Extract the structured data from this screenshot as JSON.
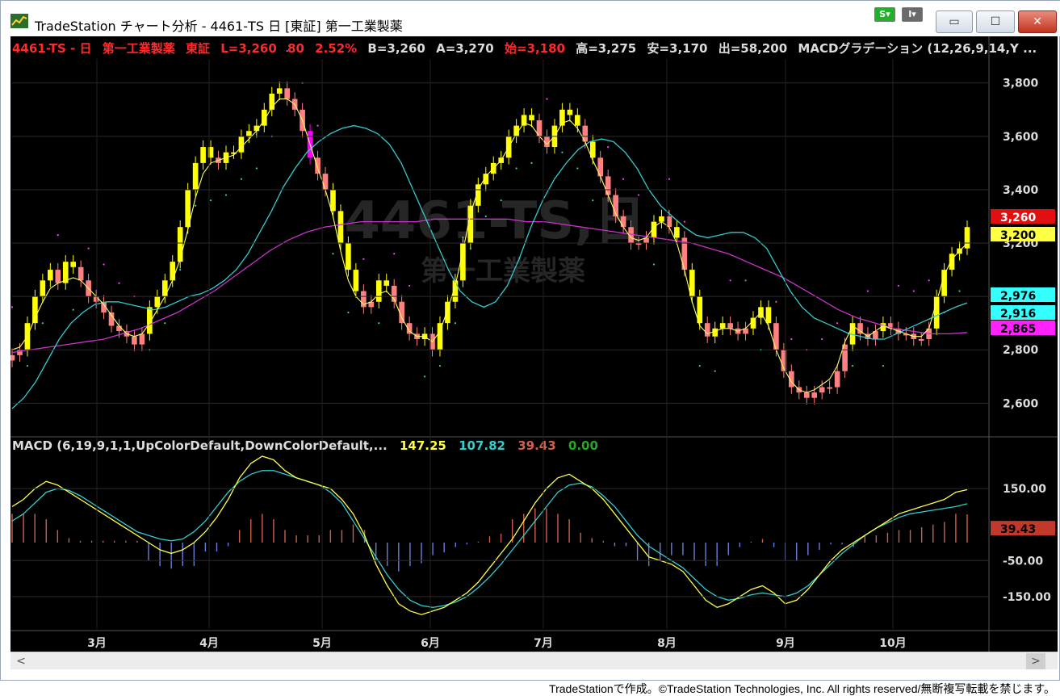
{
  "window": {
    "title": "TradeStation チャート分析 - 4461-TS 日 [東証] 第一工業製薬",
    "s_button": "S",
    "i_button": "I",
    "minimize_glyph": "▭",
    "maximize_glyph": "☐",
    "close_glyph": "✕"
  },
  "header": {
    "symbol_line": "4461-TS - 日",
    "company": "第一工業製薬",
    "exchange": "東証",
    "last": "L=3,260",
    "change": "80",
    "change_pct": "2.52%",
    "bid": "B=3,260",
    "ask": "A=3,270",
    "open": "始=3,180",
    "high": "高=3,275",
    "low": "安=3,170",
    "volume": "出=58,200",
    "indicator": "MACDグラデーション (12,26,9,14,Y ..."
  },
  "watermark": {
    "symbol": "4461-TS,日",
    "name": "第一工業製薬"
  },
  "macd_header": {
    "label": "MACD (6,19,9,1,1,UpColorDefault,DownColorDefault,...",
    "macd": "147.25",
    "signal": "107.82",
    "diff": "39.43",
    "zero": "0.00"
  },
  "price_tags": [
    "3,260",
    "3,200",
    "2,976",
    "2,916",
    "2,865"
  ],
  "macd_tag": "39.43",
  "scrollbar": {
    "left_glyph": "<",
    "right_glyph": ">"
  },
  "footer": {
    "copyright": "TradeStationで作成。©TradeStation Technologies, Inc. All rights reserved/無断複写転載を禁じます。"
  },
  "colors": {
    "up_candle": "#ffff00",
    "down_candle": "#ff00ff",
    "mid_candle": "#ff8080",
    "ma_short": "#ffff66",
    "ma_mid": "#33cccc",
    "ma_long": "#cc33cc",
    "parabolic": "#ff44ff",
    "macd_line": "#ffff44",
    "signal_line": "#33cccc",
    "hist_pos": "#d0604a",
    "hist_neg": "#6a7fd8"
  },
  "chart_data": [
    {
      "type": "candlestick",
      "x_axis_labels": [
        "3月",
        "4月",
        "5月",
        "6月",
        "7月",
        "8月",
        "9月",
        "10月"
      ],
      "y_axis_ticks": [
        2600,
        2800,
        3000,
        3200,
        3400,
        3600,
        3800
      ],
      "y_axis_tick_labels": [
        "2,600",
        "2,800",
        "3,000",
        "3,200",
        "3,400",
        "3,600",
        "3,800"
      ],
      "ylim": [
        2480,
        3890
      ],
      "closes": [
        2780,
        2800,
        2900,
        3000,
        3060,
        3100,
        3050,
        3130,
        3110,
        3060,
        3000,
        2980,
        2940,
        2890,
        2870,
        2850,
        2820,
        2860,
        2960,
        3000,
        3060,
        3130,
        3260,
        3400,
        3500,
        3560,
        3520,
        3500,
        3540,
        3540,
        3600,
        3620,
        3640,
        3700,
        3760,
        3780,
        3740,
        3700,
        3620,
        3520,
        3460,
        3400,
        3320,
        3200,
        3100,
        3020,
        2960,
        2980,
        3060,
        3040,
        2980,
        2900,
        2860,
        2840,
        2860,
        2800,
        2900,
        2980,
        3060,
        3200,
        3340,
        3420,
        3460,
        3500,
        3520,
        3600,
        3640,
        3680,
        3660,
        3600,
        3560,
        3640,
        3700,
        3680,
        3640,
        3580,
        3520,
        3450,
        3380,
        3300,
        3260,
        3200,
        3200,
        3220,
        3280,
        3300,
        3260,
        3220,
        3100,
        3000,
        2900,
        2850,
        2880,
        2900,
        2880,
        2860,
        2880,
        2920,
        2960,
        2900,
        2800,
        2720,
        2660,
        2640,
        2620,
        2640,
        2660,
        2660,
        2720,
        2820,
        2900,
        2860,
        2840,
        2870,
        2900,
        2880,
        2860,
        2860,
        2840,
        2840,
        2880,
        3000,
        3100,
        3160,
        3180,
        3260
      ],
      "ma_short": [
        2800,
        2810,
        2850,
        2920,
        2980,
        3030,
        3050,
        3060,
        3070,
        3060,
        3030,
        3000,
        2970,
        2930,
        2890,
        2860,
        2850,
        2860,
        2900,
        2950,
        3000,
        3060,
        3140,
        3250,
        3370,
        3460,
        3500,
        3510,
        3520,
        3530,
        3560,
        3590,
        3620,
        3660,
        3710,
        3740,
        3740,
        3720,
        3660,
        3570,
        3480,
        3400,
        3300,
        3170,
        3060,
        3000,
        2970,
        2980,
        3010,
        3020,
        2990,
        2920,
        2870,
        2850,
        2850,
        2830,
        2870,
        2950,
        3040,
        3170,
        3310,
        3400,
        3450,
        3480,
        3510,
        3560,
        3610,
        3650,
        3640,
        3600,
        3570,
        3600,
        3650,
        3660,
        3630,
        3580,
        3510,
        3450,
        3380,
        3310,
        3260,
        3220,
        3210,
        3220,
        3260,
        3280,
        3260,
        3200,
        3100,
        2980,
        2890,
        2860,
        2870,
        2880,
        2880,
        2870,
        2880,
        2910,
        2940,
        2890,
        2800,
        2730,
        2680,
        2650,
        2640,
        2650,
        2670,
        2690,
        2740,
        2830,
        2890,
        2870,
        2850,
        2870,
        2890,
        2880,
        2870,
        2860,
        2850,
        2850,
        2880,
        2980,
        3080,
        3140,
        3170,
        3200
      ],
      "ma_mid": [
        2580,
        2620,
        2680,
        2760,
        2840,
        2900,
        2940,
        2970,
        2980,
        2980,
        2970,
        2960,
        2950,
        2960,
        2980,
        3000,
        3010,
        3030,
        3060,
        3100,
        3160,
        3240,
        3320,
        3410,
        3480,
        3540,
        3580,
        3610,
        3630,
        3640,
        3630,
        3610,
        3570,
        3500,
        3400,
        3300,
        3200,
        3100,
        3020,
        2980,
        2960,
        2980,
        3040,
        3140,
        3260,
        3360,
        3440,
        3500,
        3550,
        3580,
        3590,
        3580,
        3540,
        3480,
        3400,
        3340,
        3300,
        3260,
        3230,
        3220,
        3230,
        3240,
        3240,
        3220,
        3180,
        3100,
        3020,
        2960,
        2920,
        2900,
        2880,
        2860,
        2850,
        2840,
        2840,
        2860,
        2880,
        2900,
        2920,
        2940,
        2960,
        2976
      ],
      "ma_long": [
        2790,
        2800,
        2810,
        2820,
        2830,
        2840,
        2860,
        2880,
        2910,
        2940,
        2980,
        3020,
        3070,
        3120,
        3170,
        3210,
        3240,
        3260,
        3270,
        3280,
        3280,
        3280,
        3280,
        3290,
        3290,
        3290,
        3290,
        3290,
        3280,
        3280,
        3270,
        3260,
        3250,
        3240,
        3230,
        3220,
        3210,
        3200,
        3180,
        3160,
        3130,
        3100,
        3070,
        3030,
        2990,
        2950,
        2920,
        2900,
        2880,
        2870,
        2860,
        2860,
        2865
      ],
      "macd": [
        100,
        120,
        150,
        170,
        160,
        140,
        120,
        100,
        80,
        60,
        40,
        20,
        0,
        -20,
        -30,
        -20,
        0,
        30,
        70,
        120,
        180,
        220,
        240,
        230,
        200,
        180,
        170,
        160,
        150,
        120,
        80,
        20,
        -60,
        -120,
        -170,
        -190,
        -200,
        -190,
        -180,
        -160,
        -140,
        -110,
        -70,
        -30,
        10,
        60,
        110,
        150,
        180,
        190,
        170,
        150,
        120,
        80,
        40,
        0,
        -40,
        -50,
        -60,
        -80,
        -120,
        -160,
        -180,
        -170,
        -150,
        -130,
        -120,
        -140,
        -170,
        -160,
        -130,
        -90,
        -50,
        -20,
        0,
        20,
        40,
        60,
        80,
        90,
        100,
        110,
        120,
        140,
        147
      ],
      "signal": [
        60,
        80,
        110,
        140,
        150,
        145,
        130,
        110,
        90,
        70,
        50,
        30,
        20,
        10,
        5,
        10,
        30,
        60,
        100,
        140,
        170,
        190,
        200,
        200,
        190,
        180,
        170,
        160,
        140,
        110,
        60,
        10,
        -40,
        -90,
        -130,
        -160,
        -175,
        -180,
        -175,
        -165,
        -150,
        -125,
        -95,
        -60,
        -20,
        20,
        60,
        100,
        140,
        160,
        165,
        155,
        130,
        100,
        60,
        20,
        -10,
        -30,
        -50,
        -70,
        -100,
        -130,
        -150,
        -160,
        -155,
        -145,
        -140,
        -145,
        -150,
        -140,
        -120,
        -90,
        -60,
        -30,
        -5,
        20,
        40,
        55,
        70,
        80,
        85,
        90,
        95,
        100,
        108
      ],
      "macd_ylim": [
        -240,
        240
      ],
      "macd_ticks": [
        150,
        -50,
        -150
      ],
      "macd_tick_labels": [
        "150.00",
        "-50.00",
        "-150.00"
      ]
    }
  ]
}
